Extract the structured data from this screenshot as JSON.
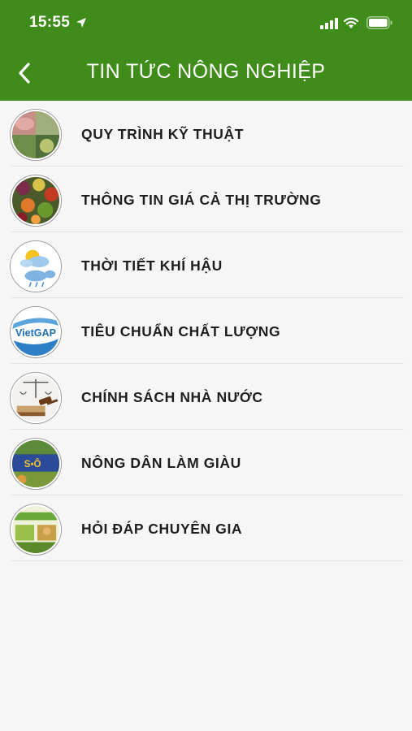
{
  "status_bar": {
    "time": "15:55",
    "icons": [
      "location-arrow-icon",
      "signal-icon",
      "wifi-icon",
      "battery-icon"
    ]
  },
  "nav": {
    "back_icon": "chevron-left-icon",
    "title": "TIN TỨC NÔNG NGHIỆP"
  },
  "colors": {
    "header_bg": "#3f8c1a",
    "page_bg": "#f6f6f6",
    "text": "#1e1e1e"
  },
  "items": [
    {
      "label": "QUY TRÌNH KỸ THUẬT",
      "thumb": "farm-process-thumbnail"
    },
    {
      "label": "THÔNG TIN GIÁ CẢ THỊ TRƯỜNG",
      "thumb": "vegetables-market-thumbnail"
    },
    {
      "label": "THỜI TIẾT KHÍ HẬU",
      "thumb": "weather-thumbnail"
    },
    {
      "label": "TIÊU CHUẨN CHẤT LƯỢNG",
      "thumb": "vietgap-logo-thumbnail",
      "thumb_text": "VietGAP"
    },
    {
      "label": "CHÍNH SÁCH NHÀ NƯỚC",
      "thumb": "law-gavel-thumbnail"
    },
    {
      "label": "NÔNG DÂN LÀM GIÀU",
      "thumb": "rich-farmer-thumbnail"
    },
    {
      "label": "HỎI ĐÁP CHUYÊN GIA",
      "thumb": "expert-qa-thumbnail"
    }
  ]
}
